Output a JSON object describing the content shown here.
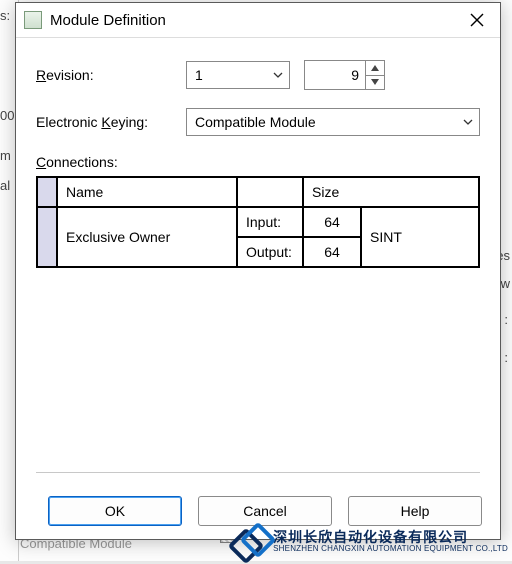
{
  "window": {
    "title": "Module Definition"
  },
  "labels": {
    "revision_pre": "R",
    "revision_post": "evision:",
    "keying_pre": "Electronic ",
    "keying_accel": "K",
    "keying_post": "eying:",
    "connections_pre": "C",
    "connections_post": "onnections:"
  },
  "revision": {
    "major": "1",
    "minor": "9"
  },
  "keying": {
    "selected": "Compatible Module"
  },
  "connections": {
    "headers": {
      "name": "Name",
      "size": "Size"
    },
    "row": {
      "name": "Exclusive Owner",
      "input_label": "Input:",
      "input_size": "64",
      "output_label": "Output:",
      "output_size": "64",
      "datatype": "SINT"
    }
  },
  "buttons": {
    "ok": "OK",
    "cancel": "Cancel",
    "help": "Help"
  },
  "background": {
    "left_s": "s:",
    "left_00": "00",
    "left_m": "m",
    "left_al": "al",
    "right_es": "es",
    "right_tw": "tw",
    "right_colon": ":",
    "right_colon2": ":",
    "bottom_text": "Compatible Module"
  },
  "watermark": {
    "cn": "深圳长欣自动化设备有限公司",
    "en": "SHENZHEN CHANGXIN AUTOMATION EQUIPMENT CO.,LTD"
  }
}
